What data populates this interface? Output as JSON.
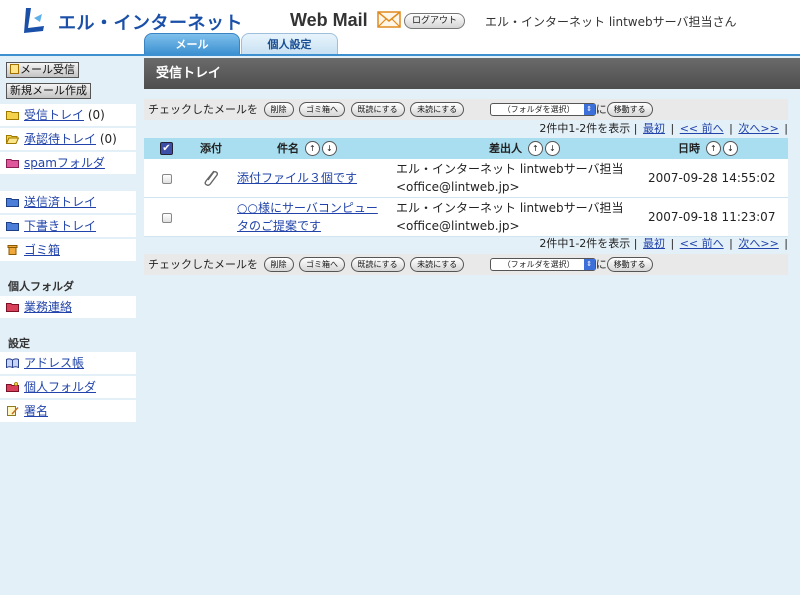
{
  "header": {
    "logo_text": "エル・インターネット",
    "app_title": "Web Mail",
    "logout_label": "ログアウト",
    "user_name": "エル・インターネット lintwebサーバ担当さん"
  },
  "tabs": [
    {
      "label": "メール",
      "active": true
    },
    {
      "label": "個人設定",
      "active": false
    }
  ],
  "sidebar": {
    "receive_button": "メール受信",
    "compose_button": "新規メール作成",
    "folders": [
      {
        "label": "受信トレイ",
        "count": "(0)",
        "icon": "folder-icon"
      },
      {
        "label": "承認待トレイ",
        "count": "(0)",
        "icon": "folder-open-icon"
      },
      {
        "label": "spamフォルダ",
        "count": "",
        "icon": "folder-icon"
      }
    ],
    "system_folders": [
      {
        "label": "送信済トレイ",
        "icon": "folder-icon"
      },
      {
        "label": "下書きトレイ",
        "icon": "folder-icon"
      },
      {
        "label": "ゴミ箱",
        "icon": "trash-icon"
      }
    ],
    "personal_heading": "個人フォルダ",
    "personal_folders": [
      {
        "label": "業務連絡",
        "icon": "folder-icon"
      }
    ],
    "settings_heading": "設定",
    "settings_items": [
      {
        "label": "アドレス帳",
        "icon": "address-book-icon"
      },
      {
        "label": "個人フォルダ",
        "icon": "folder-settings-icon"
      },
      {
        "label": "署名",
        "icon": "signature-icon"
      }
    ]
  },
  "main": {
    "title": "受信トレイ",
    "checked_label": "チェックしたメールを",
    "actions": [
      "削除",
      "ゴミ箱へ",
      "既読にする",
      "未読にする"
    ],
    "folder_select_value": "（フォルダを選択）",
    "ni_label": "に",
    "move_label": "移動する",
    "pager": {
      "summary": "2件中1-2件を表示",
      "first": "最初",
      "prev": "<< 前へ",
      "next": "次へ>>"
    },
    "columns": {
      "attach": "添付",
      "subject": "件名",
      "from": "差出人",
      "date": "日時"
    },
    "sort_up": "↑",
    "sort_down": "↓",
    "messages": [
      {
        "has_attachment": true,
        "subject": "添付ファイル３個です",
        "from_name": "エル・インターネット lintwebサーバ担当",
        "from_addr": "<office@lintweb.jp>",
        "date": "2007-09-28 14:55:02"
      },
      {
        "has_attachment": false,
        "subject_line1": "○○様にサーバコンピュー",
        "subject_line2": "タのご提案です",
        "from_name": "エル・インターネット lintwebサーバ担当",
        "from_addr": "<office@lintweb.jp>",
        "date": "2007-09-18 11:23:07"
      }
    ]
  },
  "colors": {
    "accent_blue": "#3d91d1",
    "header_gray": "#555555",
    "table_header": "#a9def0",
    "background": "#e4f0f8"
  }
}
